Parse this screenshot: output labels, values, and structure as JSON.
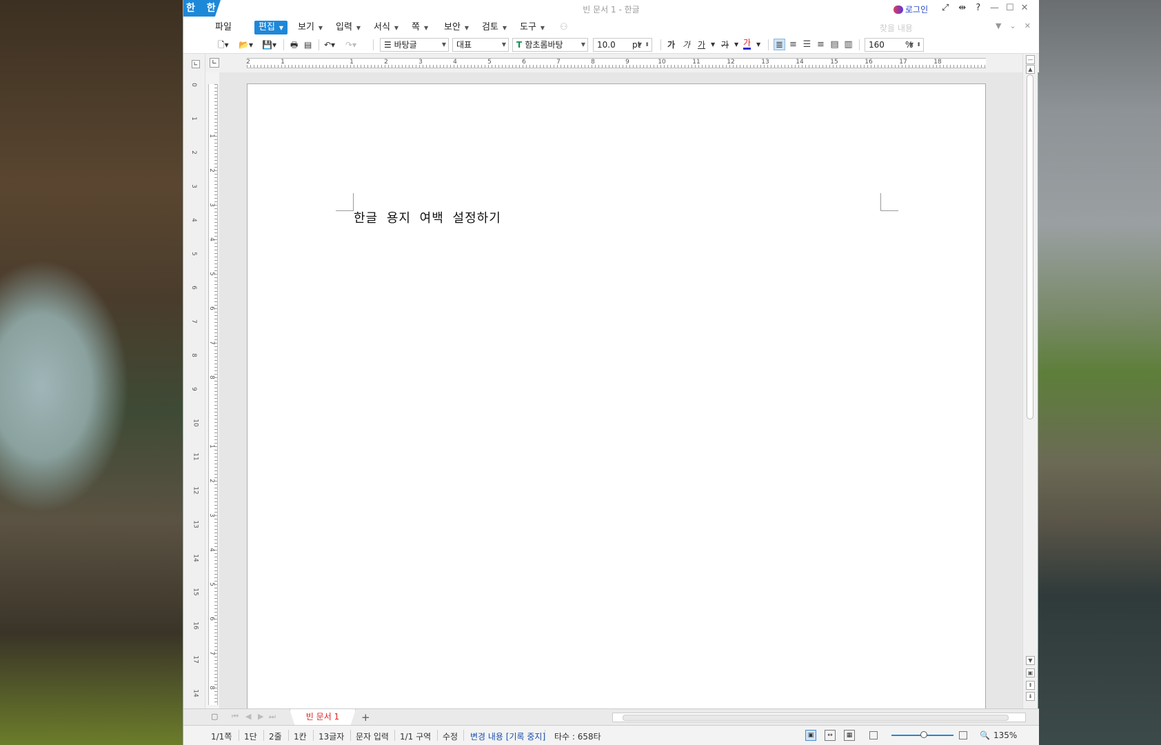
{
  "window": {
    "title": "빈 문서 1 - 한글",
    "logo": "한 한"
  },
  "titlebar": {
    "login_label": "로그인",
    "icons": [
      "fullscreen-icon",
      "split-icon",
      "help-icon"
    ],
    "help": "?"
  },
  "menu": {
    "items": [
      {
        "label": "파일",
        "has_caret": false
      },
      {
        "label": "편집",
        "has_caret": true,
        "active": true
      },
      {
        "label": "보기",
        "has_caret": true
      },
      {
        "label": "입력",
        "has_caret": true
      },
      {
        "label": "서식",
        "has_caret": true
      },
      {
        "label": "쪽",
        "has_caret": true
      },
      {
        "label": "보안",
        "has_caret": true
      },
      {
        "label": "검토",
        "has_caret": true
      },
      {
        "label": "도구",
        "has_caret": true
      }
    ],
    "search_placeholder": "찾을 내용"
  },
  "toolbar": {
    "style": "바탕글",
    "lang": "대표",
    "font": "함초롬바탕",
    "font_size": "10.0",
    "font_unit": "pt",
    "bold": "가",
    "italic": "가",
    "underline": "가",
    "strike": "가",
    "color": "가",
    "line_spacing": "160",
    "line_spacing_unit": "%"
  },
  "ruler": {
    "h_numbers": [
      "2",
      "1",
      "",
      "1",
      "2",
      "3",
      "4",
      "5",
      "6",
      "7",
      "8",
      "9",
      "10",
      "11",
      "12",
      "13",
      "14",
      "15",
      "16",
      "17",
      "18"
    ],
    "v_numbers": [
      "0",
      "1",
      "2",
      "3",
      "4",
      "5",
      "6",
      "7",
      "8",
      "9",
      "10",
      "11",
      "12",
      "13",
      "14",
      "15",
      "16",
      "17",
      "14"
    ]
  },
  "document": {
    "text": "한글 용지 여백 설정하기"
  },
  "tabs": {
    "doc_tab": "빈 문서 1",
    "add": "+"
  },
  "status": {
    "page": "1/1쪽",
    "column": "1단",
    "line": "2줄",
    "cell": "1칸",
    "chars": "13글자",
    "mode": "문자 입력",
    "section": "1/1 구역",
    "edit": "수정",
    "track": "변경 내용 [기록 중지]",
    "typing": "타수 : 658타",
    "zoom": "135%"
  }
}
